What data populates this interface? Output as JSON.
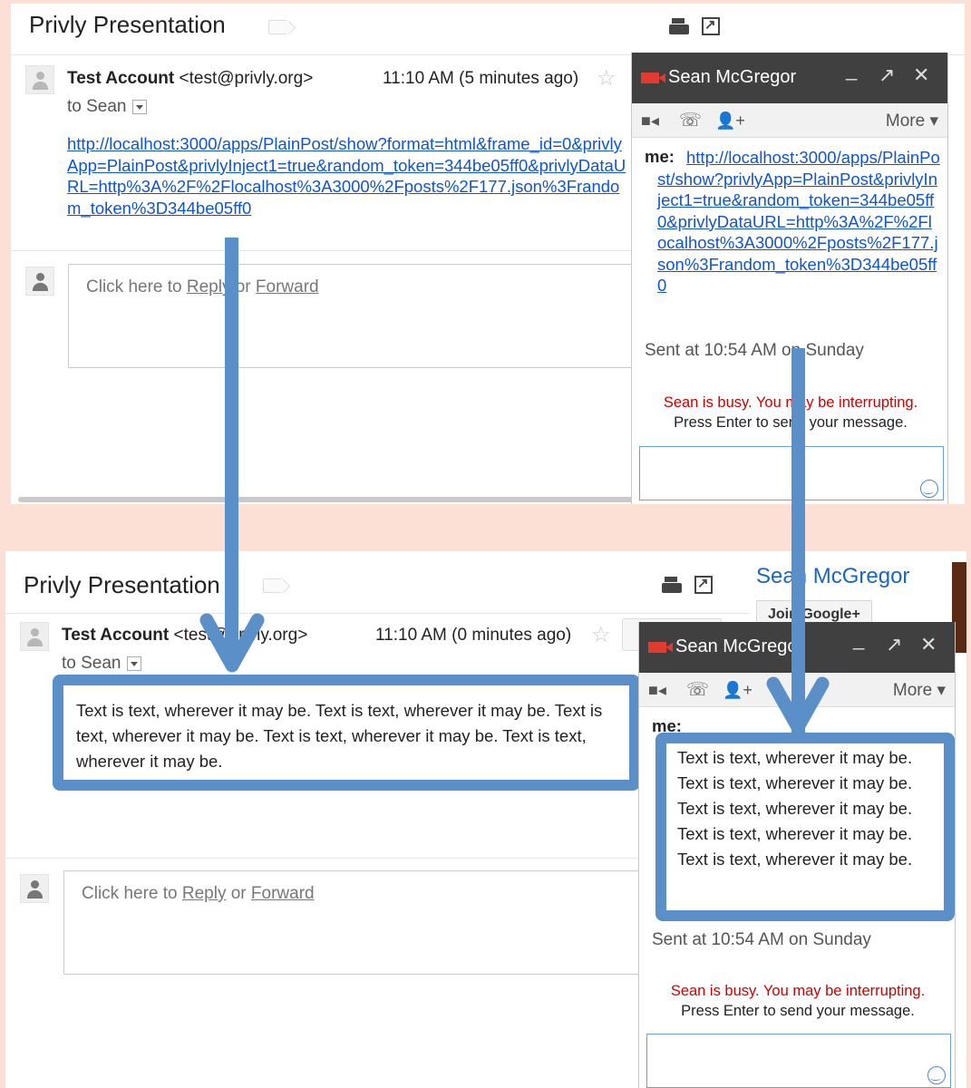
{
  "colors": {
    "background": "#fce0d6",
    "arrow": "#5b8fc7",
    "link": "#1155cc",
    "busy": "#cc0000"
  },
  "top": {
    "title": "Privly Presentation",
    "sender_name": "Test Account",
    "sender_email": "<test@privly.org>",
    "time": "11:10 AM (5 minutes ago)",
    "to": "to Sean",
    "message_link": "http://localhost:3000/apps/PlainPost/show?format=html&frame_id=0&privlyApp=PlainPost&privlyInject1=true&random_token=344be05ff0&privlyDataURL=http%3A%2F%2Flocalhost%3A3000%2Fposts%2F177.json%3Frandom_token%3D344be05ff0",
    "reply_prefix": "Click here to ",
    "reply_link": "Reply",
    "reply_mid": " or ",
    "forward_link": "Forward",
    "chat": {
      "name": "Sean McGregor",
      "more": "More ▾",
      "me": "me:",
      "chat_link": "http://localhost:3000/apps/PlainPost/show?privlyApp=PlainPost&privlyInject1=true&random_token=344be05ff0&privlyDataURL=http%3A%2F%2Flocalhost%3A3000%2Fposts%2F177.json%3Frandom_token%3D344be05ff0",
      "sent": "Sent at 10:54 AM on Sunday",
      "busy": "Sean is busy. You may be interrupting.",
      "enter": "Press Enter to send your message."
    }
  },
  "bottom": {
    "title": "Privly Presentation",
    "sender_name": "Test Account",
    "sender_email": "<test@privly.org>",
    "time": "11:10 AM (0 minutes ago)",
    "to": "to Sean",
    "message_text": "Text is text, wherever it may be. Text is text, wherever it may be. Text is text, wherever it may be. Text is text, wherever it may be. Text is text, wherever it may be.",
    "reply_prefix": "Click here to ",
    "reply_link": "Reply",
    "reply_mid": " or ",
    "forward_link": "Forward",
    "gplus_name": "Sean McGregor",
    "join_label": "Join Google+",
    "chat": {
      "name": "Sean McGregor",
      "more": "More ▾",
      "me": "me:",
      "message_text": "Text is text, wherever it may be. Text is text, wherever it may be. Text is text, wherever it may be. Text is text, wherever it may be. Text is text, wherever it may be.",
      "sent": "Sent at 10:54 AM on Sunday",
      "busy": "Sean is busy. You may be interrupting.",
      "enter": "Press Enter to send your message."
    }
  }
}
